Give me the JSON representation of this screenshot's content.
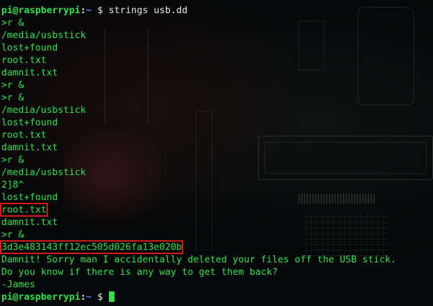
{
  "window": {
    "title": "pi@raspberrypi: ~"
  },
  "prompt": {
    "user_host": "pi@raspberrypi",
    "sep": ":",
    "path": "~",
    "symbol": "$"
  },
  "command": "strings usb.dd",
  "output": [
    ">r &",
    "/media/usbstick",
    "lost+found",
    "root.txt",
    "damnit.txt",
    ">r &",
    ">r &",
    "/media/usbstick",
    "lost+found",
    "root.txt",
    "damnit.txt",
    ">r &",
    "/media/usbstick",
    "2]8^",
    "lost+found",
    "root.txt",
    "damnit.txt",
    ">r &",
    "3d3e483143ff12ec505d026fa13e020b",
    "Damnit! Sorry man I accidentally deleted your files off the USB stick.",
    "Do you know if there is any way to get them back?",
    "",
    "-James"
  ],
  "highlighted": [
    "root.txt",
    "3d3e483143ff12ec505d026fa13e020b"
  ],
  "colors": {
    "text_green": "#2fe24a",
    "path_blue": "#4f8dff",
    "highlight_red": "#d51b1b",
    "background": "#050708"
  }
}
